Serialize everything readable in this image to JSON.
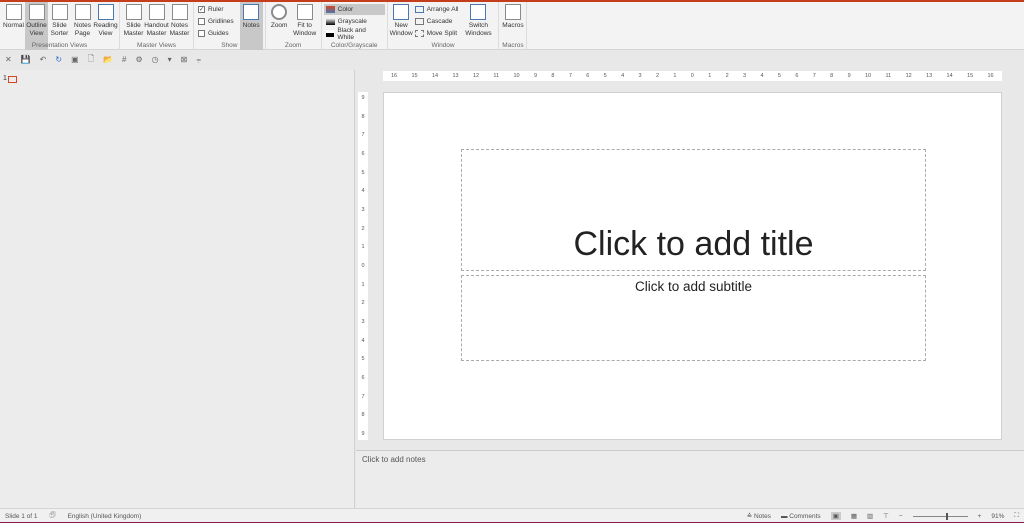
{
  "ribbon": {
    "presentation_views": {
      "label": "Presentation Views",
      "buttons": [
        "Normal",
        "Outline View",
        "Slide Sorter",
        "Notes Page",
        "Reading View"
      ],
      "selected": "Outline View"
    },
    "master_views": {
      "label": "Master Views",
      "buttons": [
        "Slide Master",
        "Handout Master",
        "Notes Master"
      ]
    },
    "show": {
      "label": "Show",
      "checks": [
        {
          "label": "Ruler",
          "checked": true
        },
        {
          "label": "Gridlines",
          "checked": false
        },
        {
          "label": "Guides",
          "checked": false
        }
      ],
      "notes": "Notes"
    },
    "zoom": {
      "label": "Zoom",
      "buttons": [
        "Zoom",
        "Fit to Window"
      ]
    },
    "color": {
      "label": "Color/Grayscale",
      "options": [
        "Color",
        "Grayscale",
        "Black and White"
      ]
    },
    "window": {
      "label": "Window",
      "new_window": "New Window",
      "options": [
        "Arrange All",
        "Cascade",
        "Move Split"
      ],
      "switch": "Switch Windows"
    },
    "macros": {
      "label": "Macros",
      "button": "Macros"
    }
  },
  "qat": [
    "✕",
    "💾",
    "↶",
    "↻",
    "▣",
    "🗋",
    "📂",
    "#",
    "⚙",
    "◷",
    "▾",
    "⊠",
    "⩦"
  ],
  "left_pane": {
    "slide_number": "1"
  },
  "ruler": {
    "h": [
      "16",
      "15",
      "14",
      "13",
      "12",
      "11",
      "10",
      "9",
      "8",
      "7",
      "6",
      "5",
      "4",
      "3",
      "2",
      "1",
      "0",
      "1",
      "2",
      "3",
      "4",
      "5",
      "6",
      "7",
      "8",
      "9",
      "10",
      "11",
      "12",
      "13",
      "14",
      "15",
      "16"
    ],
    "v": [
      "9",
      "8",
      "7",
      "6",
      "5",
      "4",
      "3",
      "2",
      "1",
      "0",
      "1",
      "2",
      "3",
      "4",
      "5",
      "6",
      "7",
      "8",
      "9"
    ]
  },
  "slide": {
    "title_placeholder": "Click to add title",
    "subtitle_placeholder": "Click to add subtitle"
  },
  "notes": {
    "placeholder": "Click to add notes"
  },
  "status": {
    "slide": "Slide 1 of 1",
    "language": "English (United Kingdom)",
    "notes": "Notes",
    "comments": "Comments",
    "zoom": "91%",
    "zoom_fraction": 0.6
  },
  "colors": {
    "accent": "#c43e1c"
  }
}
